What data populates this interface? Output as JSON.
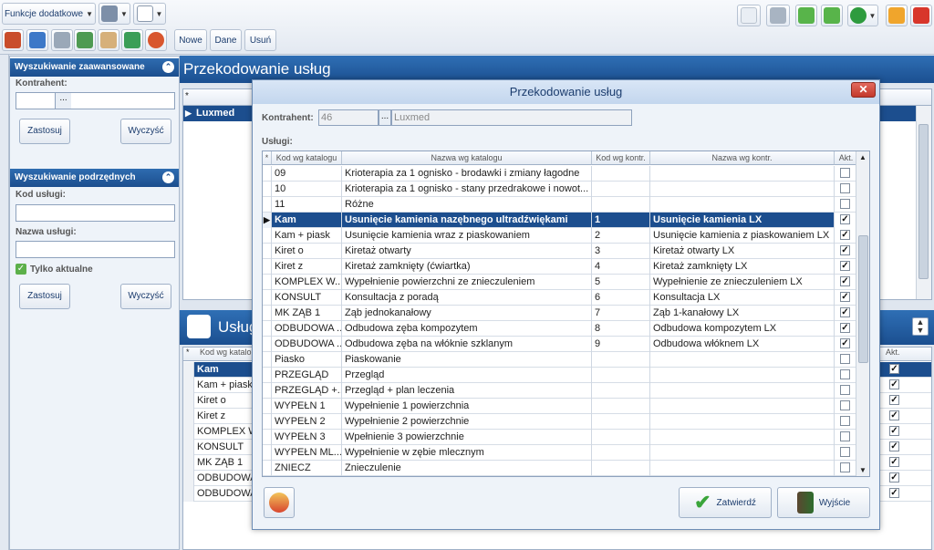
{
  "toolbar": {
    "extra_functions": "Funkcje dodatkowe",
    "new_label": "Nowe",
    "data_label": "Dane",
    "delete_label": "Usuń"
  },
  "left_panel": {
    "advanced_search_title": "Wyszukiwanie zaawansowane",
    "contractor_label": "Kontrahent:",
    "contractor_value": "",
    "apply_label": "Zastosuj",
    "clear_label": "Wyczyść",
    "sub_search_title": "Wyszukiwanie podrzędnych",
    "service_code_label": "Kod usługi:",
    "service_name_label": "Nazwa usługi:",
    "only_current_label": "Tylko aktualne",
    "only_current_checked": true,
    "apply2_label": "Zastosuj",
    "clear2_label": "Wyczyść"
  },
  "main": {
    "title": "Przekodowanie usług",
    "grid_row": "Luxmed",
    "sub_title": "Usług",
    "sub_grid": {
      "header_code": "Kod wg katalo",
      "header_akt": "Akt.",
      "rows": [
        "Kam",
        "Kam + piask",
        "Kiret o",
        "Kiret z",
        "KOMPLEX W",
        "KONSULT",
        "MK ZĄB 1",
        "ODBUDOWA",
        "ODBUDOWA"
      ],
      "checked": [
        true,
        true,
        true,
        true,
        true,
        true,
        true,
        true,
        true
      ]
    }
  },
  "modal": {
    "title": "Przekodowanie usług",
    "close": "✕",
    "contractor_label": "Kontrahent:",
    "contractor_code": "46",
    "contractor_name": "Luxmed",
    "services_label": "Usługi:",
    "columns": [
      "Kod wg katalogu",
      "Nazwa wg katalogu",
      "Kod wg kontr.",
      "Nazwa wg kontr.",
      "Akt."
    ],
    "rows": [
      {
        "code": "09",
        "name": "Krioterapia za 1 ognisko - brodawki i zmiany łagodne",
        "kcode": "",
        "kname": "",
        "akt": false
      },
      {
        "code": "10",
        "name": "Krioterapia za 1 ognisko - stany przedrakowe i nowot...",
        "kcode": "",
        "kname": "",
        "akt": false
      },
      {
        "code": "11",
        "name": "Różne",
        "kcode": "",
        "kname": "",
        "akt": false
      },
      {
        "code": "Kam",
        "name": "Usunięcie kamienia nazębnego ultradźwiękami",
        "kcode": "1",
        "kname": "Usunięcie kamienia LX",
        "akt": true,
        "selected": true
      },
      {
        "code": "Kam + piask",
        "name": "Usunięcie kamienia wraz z piaskowaniem",
        "kcode": "2",
        "kname": "Usunięcie kamienia z piaskowaniem LX",
        "akt": true
      },
      {
        "code": "Kiret o",
        "name": "Kiretaż otwarty",
        "kcode": "3",
        "kname": "Kiretaż otwarty LX",
        "akt": true
      },
      {
        "code": "Kiret z",
        "name": "Kiretaż zamknięty (ćwiartka)",
        "kcode": "4",
        "kname": "Kiretaż zamknięty LX",
        "akt": true
      },
      {
        "code": "KOMPLEX W...",
        "name": "Wypełnienie powierzchni ze znieczuleniem",
        "kcode": "5",
        "kname": "Wypełnienie ze znieczuleniem LX",
        "akt": true
      },
      {
        "code": "KONSULT",
        "name": "Konsultacja z poradą",
        "kcode": "6",
        "kname": "Konsultacja LX",
        "akt": true
      },
      {
        "code": "MK ZĄB 1",
        "name": "Ząb jednokanałowy",
        "kcode": "7",
        "kname": "Ząb 1-kanałowy LX",
        "akt": true
      },
      {
        "code": "ODBUDOWA ...",
        "name": "Odbudowa zęba kompozytem",
        "kcode": "8",
        "kname": "Odbudowa kompozytem LX",
        "akt": true
      },
      {
        "code": "ODBUDOWA ...",
        "name": "Odbudowa zęba na włóknie szklanym",
        "kcode": "9",
        "kname": "Odbudowa włóknem LX",
        "akt": true
      },
      {
        "code": "Piasko",
        "name": "Piaskowanie",
        "kcode": "",
        "kname": "",
        "akt": false
      },
      {
        "code": "PRZEGLĄD",
        "name": "Przegląd",
        "kcode": "",
        "kname": "",
        "akt": false
      },
      {
        "code": "PRZEGLĄD +...",
        "name": "Przegląd + plan leczenia",
        "kcode": "",
        "kname": "",
        "akt": false
      },
      {
        "code": "WYPEŁN 1",
        "name": "Wypełnienie 1 powierzchnia",
        "kcode": "",
        "kname": "",
        "akt": false
      },
      {
        "code": "WYPEŁN 2",
        "name": "Wypełnienie 2 powierzchnie",
        "kcode": "",
        "kname": "",
        "akt": false
      },
      {
        "code": "WYPEŁN 3",
        "name": "Wpełnienie 3 powierzchnie",
        "kcode": "",
        "kname": "",
        "akt": false
      },
      {
        "code": "WYPEŁN ML...",
        "name": "Wypełnienie w zębie mlecznym",
        "kcode": "",
        "kname": "",
        "akt": false
      },
      {
        "code": "ZNIECZ",
        "name": "Znieczulenie",
        "kcode": "",
        "kname": "",
        "akt": false
      }
    ],
    "confirm_label": "Zatwierdź",
    "exit_label": "Wyjście"
  },
  "colors": {
    "accent": "#1c4e8e",
    "header": "#2f6fb5"
  }
}
